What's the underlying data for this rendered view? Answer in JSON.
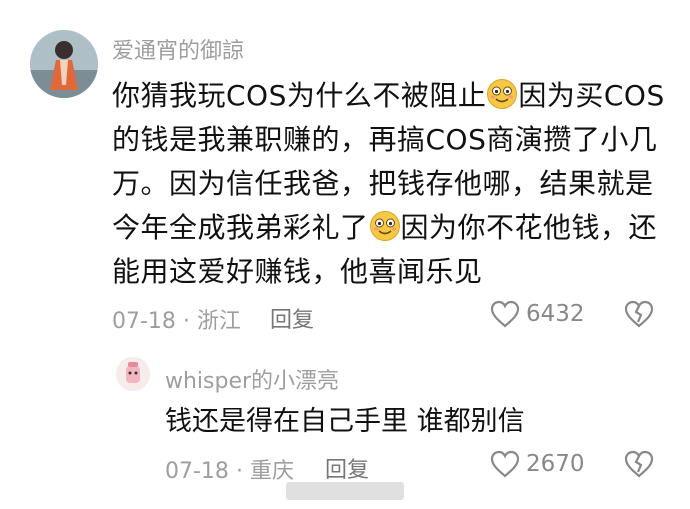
{
  "comment": {
    "username": "爱通宵的御諒",
    "lines": [
      "你猜我玩COS为什么不被阻止",
      "因为买COS",
      "的钱是我兼职赚的，再搞COS商演攒了小几",
      "万。因为信任我爸，把钱存他哪，结果就是",
      "今年全成我弟彩礼了",
      "因为你不花他钱，还",
      "能用这爱好赚钱，他喜闻乐见"
    ],
    "date": "07-18",
    "location": "浙江",
    "reply_label": "回复",
    "likes": "6432"
  },
  "reply": {
    "username": "whisper的小漂亮",
    "text": "钱还是得在自己手里 谁都别信",
    "date": "07-18",
    "location": "重庆",
    "reply_label": "回复",
    "likes": "2670"
  },
  "meta_separator": "·",
  "icons": [
    "heart-icon",
    "broken-heart-icon",
    "smile-emoji-icon"
  ],
  "colors": {
    "meta_gray": "#9e9e9e",
    "text": "#111111",
    "emoji_yellow": "#f6c844"
  }
}
